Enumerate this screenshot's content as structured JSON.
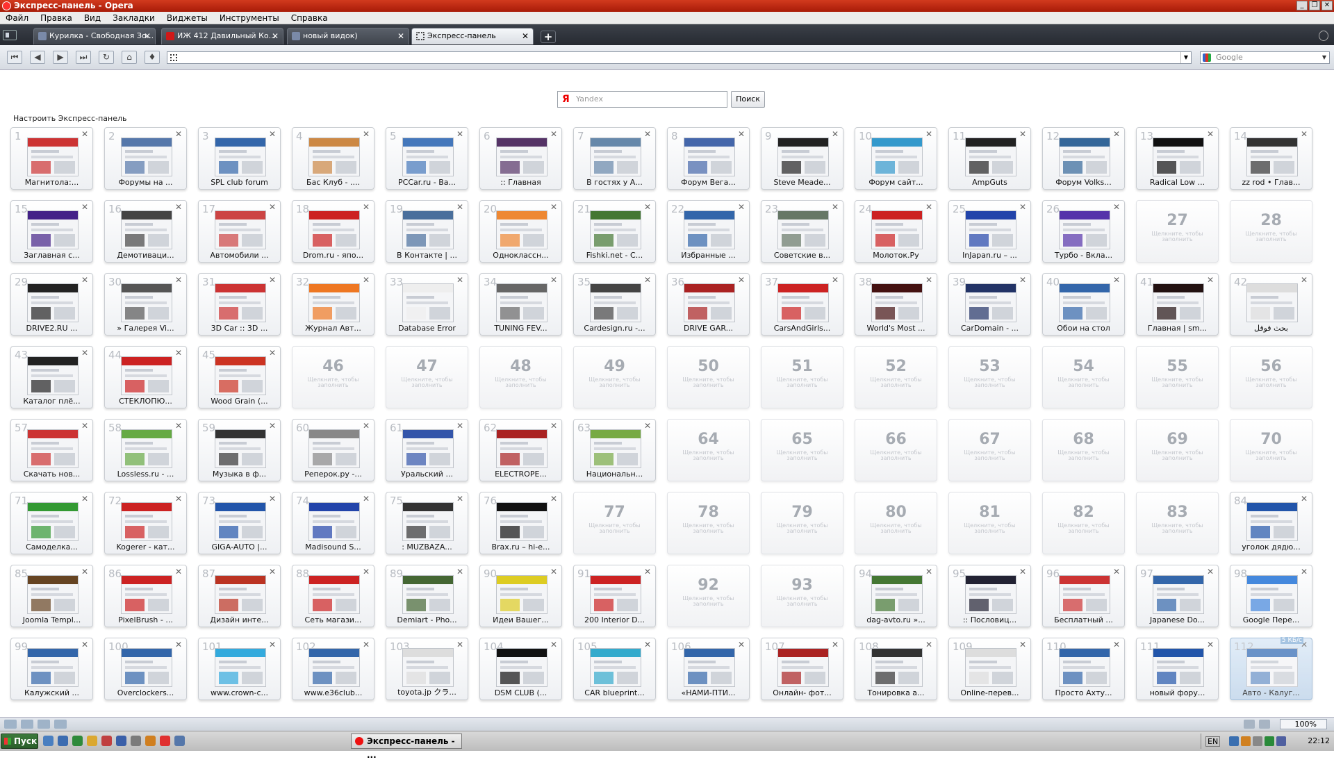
{
  "window": {
    "title": "Экспресс-панель - Opera"
  },
  "menu": [
    "Файл",
    "Правка",
    "Вид",
    "Закладки",
    "Виджеты",
    "Инструменты",
    "Справка"
  ],
  "tabs": [
    {
      "label": "Курилка - Свободная Зо...",
      "icon": "page-icon",
      "active": false
    },
    {
      "label": "ИЖ 412 Давильный Ко...",
      "icon": "red-d-icon",
      "active": false
    },
    {
      "label": "новый видок)",
      "icon": "page-icon",
      "active": false
    },
    {
      "label": "Экспресс-панель",
      "icon": "grid-icon",
      "active": true
    }
  ],
  "search_engine": {
    "placeholder": "Google"
  },
  "speed_dial": {
    "search_placeholder": "Yandex",
    "search_button": "Поиск",
    "configure_label": "Настроить Экспресс-панель",
    "empty_hint": "Щелкните, чтобы заполнить",
    "cells": [
      {
        "n": 1,
        "label": "Магнитола:...",
        "color": "#cc3333"
      },
      {
        "n": 2,
        "label": "Форумы на ...",
        "color": "#5577aa"
      },
      {
        "n": 3,
        "label": "SPL club forum",
        "color": "#3366aa"
      },
      {
        "n": 4,
        "label": "Бас Клуб - ....",
        "color": "#cc8844"
      },
      {
        "n": 5,
        "label": "PCCar.ru - Ва...",
        "color": "#4477bb"
      },
      {
        "n": 6,
        "label": ":: Главная",
        "color": "#553366"
      },
      {
        "n": 7,
        "label": "В гостях у А...",
        "color": "#6688aa"
      },
      {
        "n": 8,
        "label": "Форум Вега...",
        "color": "#4466aa"
      },
      {
        "n": 9,
        "label": "Steve Meade...",
        "color": "#222222"
      },
      {
        "n": 10,
        "label": "Форум сайт...",
        "color": "#3399cc"
      },
      {
        "n": 11,
        "label": "AmpGuts",
        "color": "#222222"
      },
      {
        "n": 12,
        "label": "Форум Volks...",
        "color": "#336699"
      },
      {
        "n": 13,
        "label": "Radical Low ...",
        "color": "#111111"
      },
      {
        "n": 14,
        "label": "zz rod • Глав...",
        "color": "#333333"
      },
      {
        "n": 15,
        "label": "Заглавная с...",
        "color": "#442288"
      },
      {
        "n": 16,
        "label": "Демотиваци...",
        "color": "#444444"
      },
      {
        "n": 17,
        "label": "Автомобили ...",
        "color": "#cc4444"
      },
      {
        "n": 18,
        "label": "Drom.ru - япо...",
        "color": "#cc2222"
      },
      {
        "n": 19,
        "label": "В Контакте | ...",
        "color": "#4a6f9c"
      },
      {
        "n": 20,
        "label": "Одноклассн...",
        "color": "#ee8833"
      },
      {
        "n": 21,
        "label": "Fishki.net - С...",
        "color": "#447733"
      },
      {
        "n": 22,
        "label": "Избранные ...",
        "color": "#3366aa"
      },
      {
        "n": 23,
        "label": "Советские в...",
        "color": "#667766"
      },
      {
        "n": 24,
        "label": "Молоток.Ру",
        "color": "#cc2222"
      },
      {
        "n": 25,
        "label": "InJapan.ru – ...",
        "color": "#2244aa"
      },
      {
        "n": 26,
        "label": "Турбо - Вкла...",
        "color": "#5533aa"
      },
      {
        "n": 27,
        "empty": true
      },
      {
        "n": 28,
        "empty": true
      },
      {
        "n": 29,
        "label": "DRIVE2.RU ...",
        "color": "#222222"
      },
      {
        "n": 30,
        "label": "» Галерея Vi...",
        "color": "#555555"
      },
      {
        "n": 31,
        "label": "3D Car :: 3D ...",
        "color": "#cc3333"
      },
      {
        "n": 32,
        "label": "Журнал Авт...",
        "color": "#ee7722"
      },
      {
        "n": 33,
        "label": "Database Error",
        "color": "#eeeeee"
      },
      {
        "n": 34,
        "label": "TUNING FEV...",
        "color": "#666666"
      },
      {
        "n": 35,
        "label": "Cardesign.ru -...",
        "color": "#444444"
      },
      {
        "n": 36,
        "label": "DRIVE GAR...",
        "color": "#aa2222"
      },
      {
        "n": 37,
        "label": "CarsAndGirls...",
        "color": "#cc2222"
      },
      {
        "n": 38,
        "label": "World's Most ...",
        "color": "#441111"
      },
      {
        "n": 39,
        "label": "CarDomain - ...",
        "color": "#223366"
      },
      {
        "n": 40,
        "label": "Обои на стол",
        "color": "#3366aa"
      },
      {
        "n": 41,
        "label": "Главная | sm...",
        "color": "#221111"
      },
      {
        "n": 42,
        "label": "بحث قوقل",
        "color": "#dddddd"
      },
      {
        "n": 43,
        "label": "Каталог плё...",
        "color": "#222222"
      },
      {
        "n": 44,
        "label": "СТЕКЛОПЮ...",
        "color": "#cc2222"
      },
      {
        "n": 45,
        "label": "Wood Grain (...",
        "color": "#cc3322"
      },
      {
        "n": 46,
        "empty": true
      },
      {
        "n": 47,
        "empty": true
      },
      {
        "n": 48,
        "empty": true
      },
      {
        "n": 49,
        "empty": true
      },
      {
        "n": 50,
        "empty": true
      },
      {
        "n": 51,
        "empty": true
      },
      {
        "n": 52,
        "empty": true
      },
      {
        "n": 53,
        "empty": true
      },
      {
        "n": 54,
        "empty": true
      },
      {
        "n": 55,
        "empty": true
      },
      {
        "n": 56,
        "empty": true
      },
      {
        "n": 57,
        "label": "Скачать нов...",
        "color": "#cc3333"
      },
      {
        "n": 58,
        "label": "Lossless.ru - ...",
        "color": "#66aa44"
      },
      {
        "n": 59,
        "label": "Музыка в ф...",
        "color": "#333333"
      },
      {
        "n": 60,
        "label": "Реперок.ру -...",
        "color": "#888888"
      },
      {
        "n": 61,
        "label": "Уральский ...",
        "color": "#3355aa"
      },
      {
        "n": 62,
        "label": "ELECTROPE...",
        "color": "#aa2222"
      },
      {
        "n": 63,
        "label": "Национальн...",
        "color": "#77aa44"
      },
      {
        "n": 64,
        "empty": true
      },
      {
        "n": 65,
        "empty": true
      },
      {
        "n": 66,
        "empty": true
      },
      {
        "n": 67,
        "empty": true
      },
      {
        "n": 68,
        "empty": true
      },
      {
        "n": 69,
        "empty": true
      },
      {
        "n": 70,
        "empty": true
      },
      {
        "n": 71,
        "label": "Самоделка...",
        "color": "#339933"
      },
      {
        "n": 72,
        "label": "Kogerer - кат...",
        "color": "#cc2222"
      },
      {
        "n": 73,
        "label": "GIGA-AUTO |...",
        "color": "#2255aa"
      },
      {
        "n": 74,
        "label": "Madisound S...",
        "color": "#2244aa"
      },
      {
        "n": 75,
        "label": ": MUZBAZA...",
        "color": "#333333"
      },
      {
        "n": 76,
        "label": "Brax.ru – hi-e...",
        "color": "#111111"
      },
      {
        "n": 77,
        "empty": true
      },
      {
        "n": 78,
        "empty": true
      },
      {
        "n": 79,
        "empty": true
      },
      {
        "n": 80,
        "empty": true
      },
      {
        "n": 81,
        "empty": true
      },
      {
        "n": 82,
        "empty": true
      },
      {
        "n": 83,
        "empty": true
      },
      {
        "n": 84,
        "label": "уголок дядю...",
        "color": "#2255aa"
      },
      {
        "n": 85,
        "label": "Joomla Templ...",
        "color": "#664422"
      },
      {
        "n": 86,
        "label": "PixelBrush - ...",
        "color": "#cc2222"
      },
      {
        "n": 87,
        "label": "Дизайн инте...",
        "color": "#bb3322"
      },
      {
        "n": 88,
        "label": "Сеть магази...",
        "color": "#cc2222"
      },
      {
        "n": 89,
        "label": "Demiart - Pho...",
        "color": "#446633"
      },
      {
        "n": 90,
        "label": "Идеи Вашег...",
        "color": "#ddcc22"
      },
      {
        "n": 91,
        "label": "200 Interior D...",
        "color": "#cc2222"
      },
      {
        "n": 92,
        "empty": true
      },
      {
        "n": 93,
        "empty": true
      },
      {
        "n": 94,
        "label": "dag-avto.ru »...",
        "color": "#447733"
      },
      {
        "n": 95,
        "label": ":: Пословиц...",
        "color": "#222233"
      },
      {
        "n": 96,
        "label": "Бесплатный ...",
        "color": "#cc3333"
      },
      {
        "n": 97,
        "label": "Japanese Do...",
        "color": "#3366aa"
      },
      {
        "n": 98,
        "label": "Google Пере...",
        "color": "#4488dd"
      },
      {
        "n": 99,
        "label": "Калужский ...",
        "color": "#3366aa"
      },
      {
        "n": 100,
        "label": "Overclockers...",
        "color": "#3366aa"
      },
      {
        "n": 101,
        "label": "www.crown-c...",
        "color": "#33aadd"
      },
      {
        "n": 102,
        "label": "www.e36club...",
        "color": "#3366aa"
      },
      {
        "n": 103,
        "label": "toyota.jp クラ...",
        "color": "#dddddd"
      },
      {
        "n": 104,
        "label": "DSM CLUB (...",
        "color": "#111111"
      },
      {
        "n": 105,
        "label": "CAR blueprint...",
        "color": "#33aacc"
      },
      {
        "n": 106,
        "label": "«НАМИ-ПТИ...",
        "color": "#3366aa"
      },
      {
        "n": 107,
        "label": "Онлайн- фот...",
        "color": "#aa2222"
      },
      {
        "n": 108,
        "label": "Тонировка а...",
        "color": "#333333"
      },
      {
        "n": 109,
        "label": "Online-перев...",
        "color": "#dddddd"
      },
      {
        "n": 110,
        "label": "Просто Ахту...",
        "color": "#3366aa"
      },
      {
        "n": 111,
        "label": "новый фору...",
        "color": "#2255aa"
      },
      {
        "n": 112,
        "label": "Авто - Калуг...",
        "color": "#4477bb",
        "ghost": true,
        "badge": "5 КБ/с"
      }
    ]
  },
  "statusbar": {
    "zoom": "100%"
  },
  "taskbar": {
    "start_label": "Пуск",
    "task_label": "Экспресс-панель - ...",
    "lang": "EN",
    "clock": "22:12"
  }
}
